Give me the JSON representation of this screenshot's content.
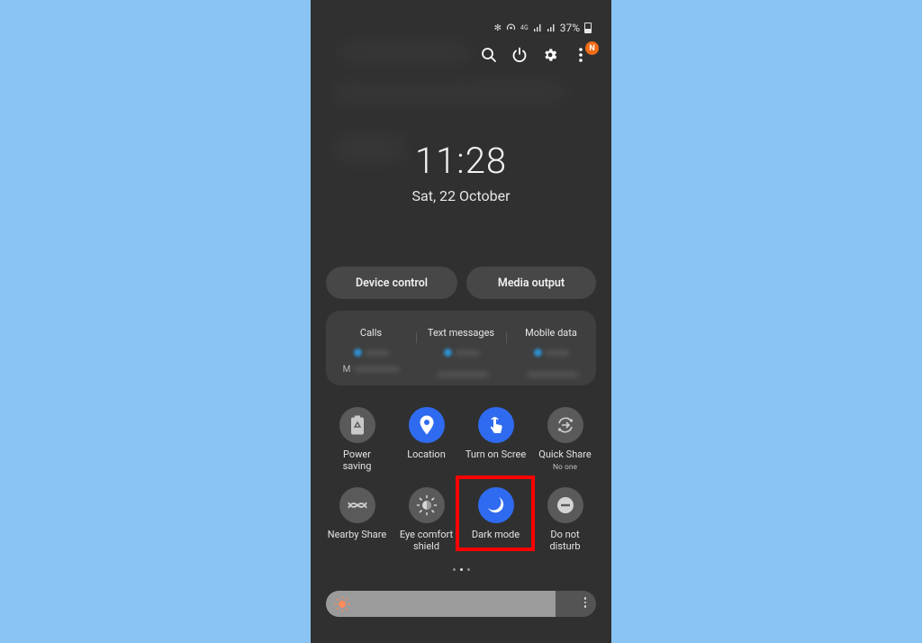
{
  "status_bar": {
    "battery_percent": "37%",
    "icons": [
      "bluetooth-icon",
      "hotspot-icon",
      "4g-icon",
      "signal-icon",
      "signal-icon",
      "battery-icon"
    ],
    "network_label": "4G"
  },
  "top_actions": {
    "icons": [
      "search-icon",
      "power-icon",
      "gear-icon",
      "more-icon"
    ],
    "notification_badge": "N"
  },
  "clock": {
    "time": "11:28",
    "date": "Sat, 22 October"
  },
  "buttons": {
    "device_control": "Device control",
    "media_output": "Media output"
  },
  "sim": {
    "columns": [
      {
        "label": "Calls",
        "sub_prefix": "M"
      },
      {
        "label": "Text messages",
        "sub_prefix": ""
      },
      {
        "label": "Mobile data",
        "sub_prefix": ""
      }
    ]
  },
  "tiles": [
    {
      "label": "Power",
      "label2": "saving",
      "sub": "",
      "icon": "battery-recycle-icon",
      "on": false
    },
    {
      "label": "Location",
      "label2": "",
      "sub": "",
      "icon": "location-pin-icon",
      "on": true
    },
    {
      "label": "Turn on Scree",
      "label2": "",
      "sub": "",
      "icon": "touch-hand-icon",
      "on": true
    },
    {
      "label": "Quick Share",
      "label2": "",
      "sub": "No one",
      "icon": "quick-share-icon",
      "on": false
    },
    {
      "label": "Nearby Share",
      "label2": "",
      "sub": "",
      "icon": "nearby-share-icon",
      "on": false
    },
    {
      "label": "Eye comfort",
      "label2": "shield",
      "sub": "",
      "icon": "eye-comfort-icon",
      "on": false
    },
    {
      "label": "Dark mode",
      "label2": "",
      "sub": "",
      "icon": "moon-icon",
      "on": true
    },
    {
      "label": "Do not",
      "label2": "disturb",
      "sub": "",
      "icon": "do-not-disturb-icon",
      "on": false
    }
  ],
  "pagination": {
    "pages": 3,
    "active": 2
  },
  "brightness": {
    "level_percent": 85
  },
  "colors": {
    "background": "#89c4f4",
    "panel": "#303030",
    "accent_on": "#2f6bf0",
    "badge": "#f26b15",
    "highlight": "#ff0000",
    "sun": "#ff8a5c"
  }
}
